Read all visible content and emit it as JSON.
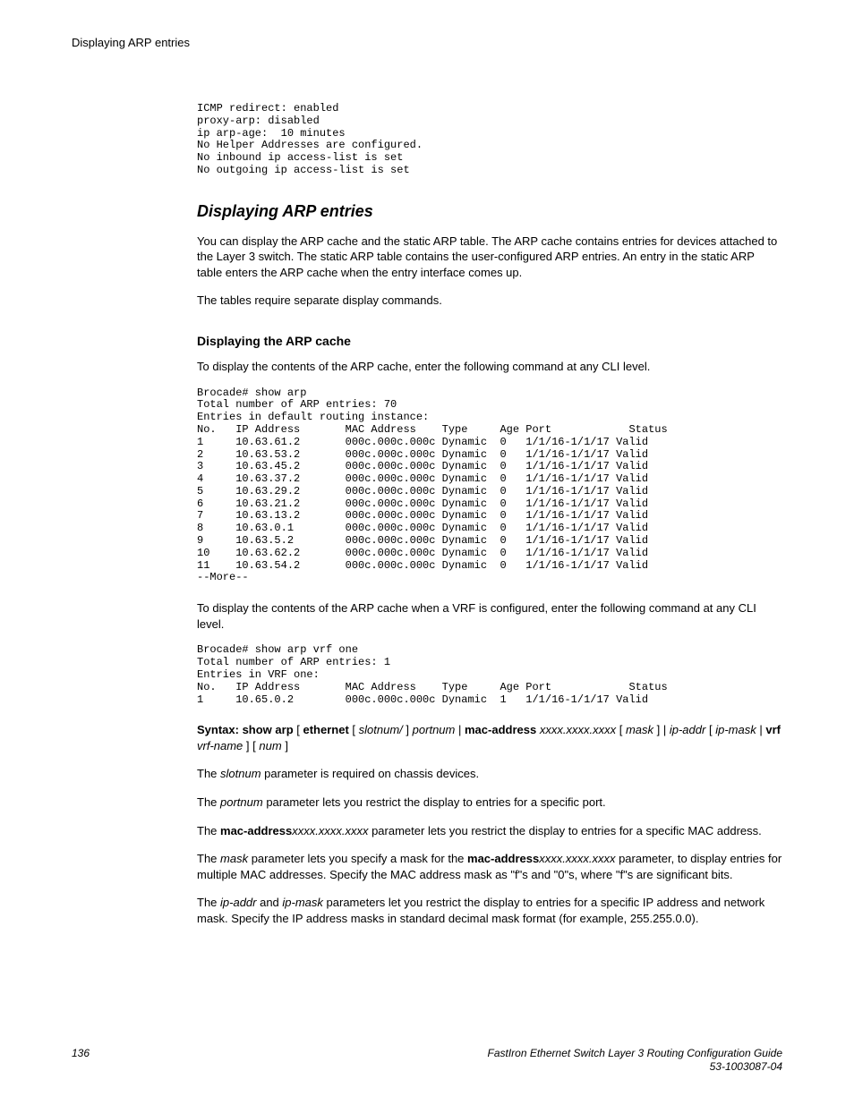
{
  "running_head": "Displaying ARP entries",
  "pre_intro": "ICMP redirect: enabled\nproxy-arp: disabled\nip arp-age:  10 minutes\nNo Helper Addresses are configured.\nNo inbound ip access-list is set\nNo outgoing ip access-list is set",
  "section_title": "Displaying ARP entries",
  "para1": "You can display the ARP cache and the static ARP table. The ARP cache contains entries for devices attached to the Layer 3 switch. The static ARP table contains the user-configured ARP entries. An entry in the static ARP table enters the ARP cache when the entry interface comes up.",
  "para2": "The tables require separate display commands.",
  "sub1_title": "Displaying the ARP cache",
  "sub1_lead": "To display the contents of the ARP cache, enter the following command at any CLI level.",
  "cli1": "Brocade# show arp\nTotal number of ARP entries: 70\nEntries in default routing instance:\nNo.   IP Address       MAC Address    Type     Age Port            Status\n1     10.63.61.2       000c.000c.000c Dynamic  0   1/1/16-1/1/17 Valid\n2     10.63.53.2       000c.000c.000c Dynamic  0   1/1/16-1/1/17 Valid\n3     10.63.45.2       000c.000c.000c Dynamic  0   1/1/16-1/1/17 Valid\n4     10.63.37.2       000c.000c.000c Dynamic  0   1/1/16-1/1/17 Valid\n5     10.63.29.2       000c.000c.000c Dynamic  0   1/1/16-1/1/17 Valid\n6     10.63.21.2       000c.000c.000c Dynamic  0   1/1/16-1/1/17 Valid\n7     10.63.13.2       000c.000c.000c Dynamic  0   1/1/16-1/1/17 Valid\n8     10.63.0.1        000c.000c.000c Dynamic  0   1/1/16-1/1/17 Valid\n9     10.63.5.2        000c.000c.000c Dynamic  0   1/1/16-1/1/17 Valid\n10    10.63.62.2       000c.000c.000c Dynamic  0   1/1/16-1/1/17 Valid\n11    10.63.54.2       000c.000c.000c Dynamic  0   1/1/16-1/1/17 Valid\n--More--",
  "para3": "To display the contents of the ARP cache when a VRF is configured, enter the following command at any CLI level.",
  "cli2": "Brocade# show arp vrf one\nTotal number of ARP entries: 1\nEntries in VRF one:\nNo.   IP Address       MAC Address    Type     Age Port            Status\n1     10.65.0.2        000c.000c.000c Dynamic  1   1/1/16-1/1/17 Valid",
  "syntax": {
    "lead": "Syntax: show arp",
    "eth": "ethernet",
    "slot": "slotnum/",
    "port": "portnum",
    "mac": "mac-address",
    "macfmt": "xxxx.xxxx.xxxx",
    "mask": "mask",
    "ipaddr": "ip-addr",
    "ipmask": "ip-mask",
    "vrf": "vrf",
    "vrfname": "vrf-name",
    "num": "num"
  },
  "p_slot_a": "The ",
  "p_slot_i": "slotnum",
  "p_slot_b": " parameter is required on chassis devices.",
  "p_port_a": "The ",
  "p_port_i": "portnum",
  "p_port_b": " parameter lets you restrict the display to entries for a specific port.",
  "p_mac_a": "The ",
  "p_mac_b": "mac-address",
  "p_mac_i": "xxxx.xxxx.xxxx",
  "p_mac_c": " parameter lets you restrict the display to entries for a specific MAC address.",
  "p_mask_a": "The ",
  "p_mask_i1": "mask",
  "p_mask_b": " parameter lets you specify a mask for the ",
  "p_mask_bold": "mac-address",
  "p_mask_i2": "xxxx.xxxx.xxxx",
  "p_mask_c": " parameter, to display entries for multiple MAC addresses. Specify the MAC address mask as \"f\"s and \"0\"s, where \"f\"s are significant bits.",
  "p_ip_a": "The ",
  "p_ip_i1": "ip-addr",
  "p_ip_mid": " and ",
  "p_ip_i2": "ip-mask",
  "p_ip_b": " parameters let you restrict the display to entries for a specific IP address and network mask. Specify the IP address masks in standard decimal mask format (for example, 255.255.0.0).",
  "footer": {
    "page": "136",
    "doc1": "FastIron Ethernet Switch Layer 3 Routing Configuration Guide",
    "doc2": "53-1003087-04"
  }
}
